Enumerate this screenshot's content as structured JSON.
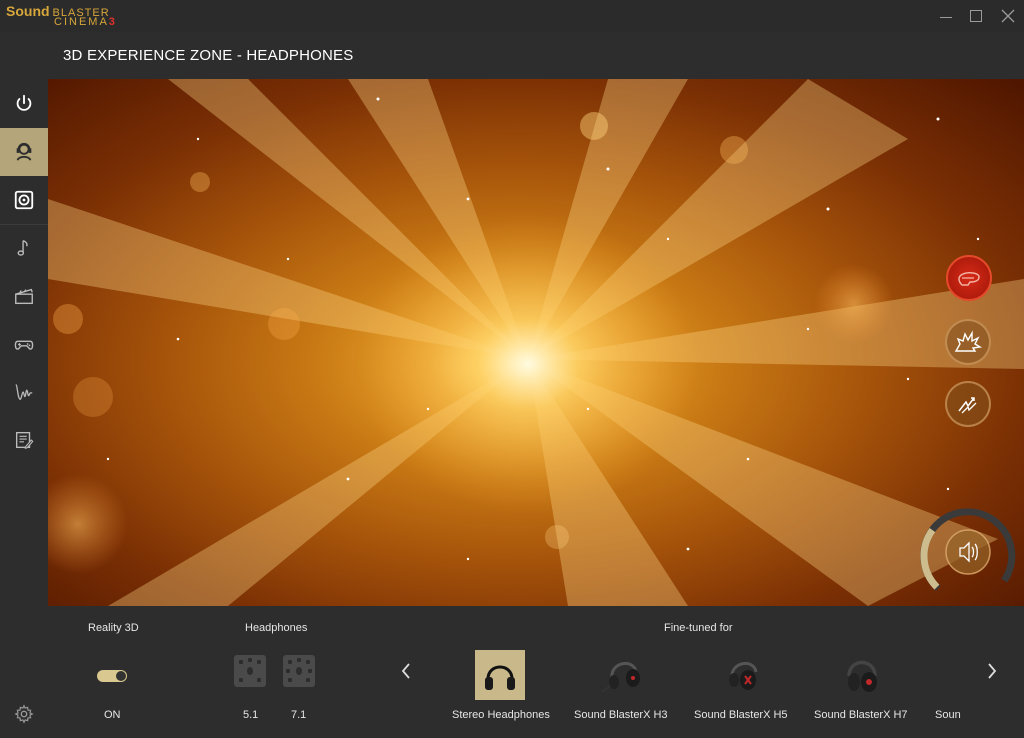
{
  "app": {
    "logo_line1": "Sound",
    "logo_line1_small": "BLASTER",
    "logo_line2": "CINEMA",
    "logo_number": "3"
  },
  "header": {
    "title": "3D EXPERIENCE ZONE - HEADPHONES"
  },
  "sidebar": {
    "items": [
      {
        "icon": "power-icon"
      },
      {
        "icon": "headphone-user-icon",
        "active": true
      },
      {
        "icon": "speaker-icon"
      },
      {
        "icon": "music-note-icon"
      },
      {
        "icon": "clapperboard-icon"
      },
      {
        "icon": "gamepad-icon"
      },
      {
        "icon": "waveform-icon"
      },
      {
        "icon": "edit-notes-icon"
      }
    ],
    "settings_icon": "gear-icon"
  },
  "effects": [
    {
      "icon": "helmet-icon",
      "state": "active",
      "color": "#d82a18"
    },
    {
      "icon": "explosion-icon",
      "state": "inactive"
    },
    {
      "icon": "lightning-icon",
      "state": "inactive"
    }
  ],
  "volume": {
    "icon": "speaker-volume-icon",
    "level": 0.3
  },
  "bottom": {
    "reality3d": {
      "title": "Reality 3D",
      "state": "ON"
    },
    "headphones": {
      "title": "Headphones",
      "options": [
        "5.1",
        "7.1"
      ]
    },
    "finetuned": {
      "title": "Fine-tuned for",
      "items": [
        {
          "label": "Stereo Headphones",
          "selected": true
        },
        {
          "label": "Sound BlasterX H3"
        },
        {
          "label": "Sound BlasterX H5"
        },
        {
          "label": "Sound BlasterX H7"
        },
        {
          "label": "Soun"
        }
      ]
    }
  },
  "colors": {
    "accent": "#b5a57a",
    "toggle": "#d9c88f",
    "logo_gold": "#d7a63a",
    "logo_red": "#e0312a",
    "panel": "#2d2d2d"
  }
}
